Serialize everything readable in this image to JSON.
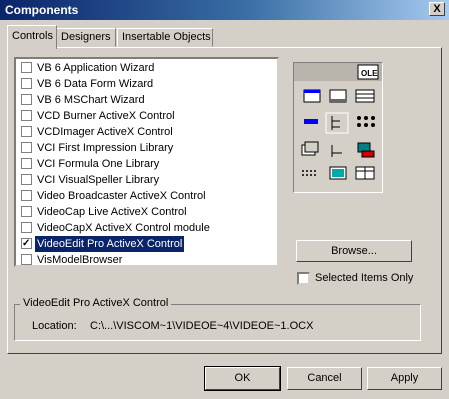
{
  "window": {
    "title": "Components",
    "close_label": "X"
  },
  "tabs": [
    {
      "label": "Controls"
    },
    {
      "label": "Designers"
    },
    {
      "label": "Insertable Objects"
    }
  ],
  "list": {
    "items": [
      {
        "label": "VB 6 Application Wizard",
        "checked": false
      },
      {
        "label": "VB 6 Data Form Wizard",
        "checked": false
      },
      {
        "label": "VB 6 MSChart Wizard",
        "checked": false
      },
      {
        "label": "VCD Burner ActiveX Control",
        "checked": false
      },
      {
        "label": "VCDImager ActiveX Control",
        "checked": false
      },
      {
        "label": "VCI First Impression Library",
        "checked": false
      },
      {
        "label": "VCI Formula One Library",
        "checked": false
      },
      {
        "label": "VCI VisualSpeller Library",
        "checked": false
      },
      {
        "label": "Video Broadcaster ActiveX Control",
        "checked": false
      },
      {
        "label": "VideoCap Live ActiveX Control",
        "checked": false
      },
      {
        "label": "VideoCapX ActiveX Control module",
        "checked": false
      },
      {
        "label": "VideoEdit Pro ActiveX Control",
        "checked": true,
        "selected": true
      },
      {
        "label": "VisModelBrowser",
        "checked": false
      }
    ]
  },
  "toolbox": {
    "badge": "OLE"
  },
  "buttons": {
    "browse": "Browse...",
    "ok": "OK",
    "cancel": "Cancel",
    "apply": "Apply"
  },
  "selected_only": {
    "label": "Selected Items Only",
    "checked": false
  },
  "details": {
    "title": "VideoEdit Pro ActiveX Control",
    "location_label": "Location:",
    "location_value": "C:\\...\\VISCOM~1\\VIDEOE~4\\VIDEOE~1.OCX"
  }
}
